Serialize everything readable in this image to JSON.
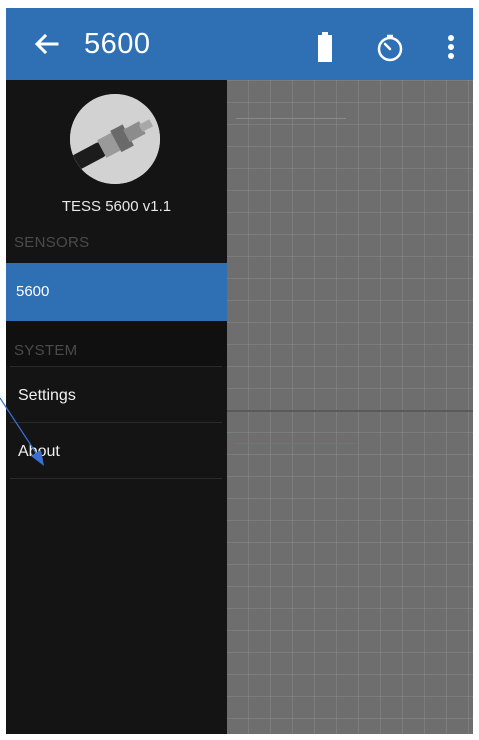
{
  "app_bar": {
    "title": "5600",
    "icons": {
      "back": "arrow-left-icon",
      "battery": "battery-full-icon",
      "timer": "timer-icon",
      "more": "more-vertical-icon"
    },
    "color": "#2f6fb3"
  },
  "drawer": {
    "device_name": "TESS 5600 v1.1",
    "sections": {
      "sensors": "SENSORS",
      "system": "SYSTEM"
    },
    "items": {
      "sensor_5600": "5600",
      "settings": "Settings",
      "about": "About"
    },
    "active_color": "#2f6fb3",
    "background": "#141414"
  },
  "content": {
    "background": "#6e6e6e"
  }
}
